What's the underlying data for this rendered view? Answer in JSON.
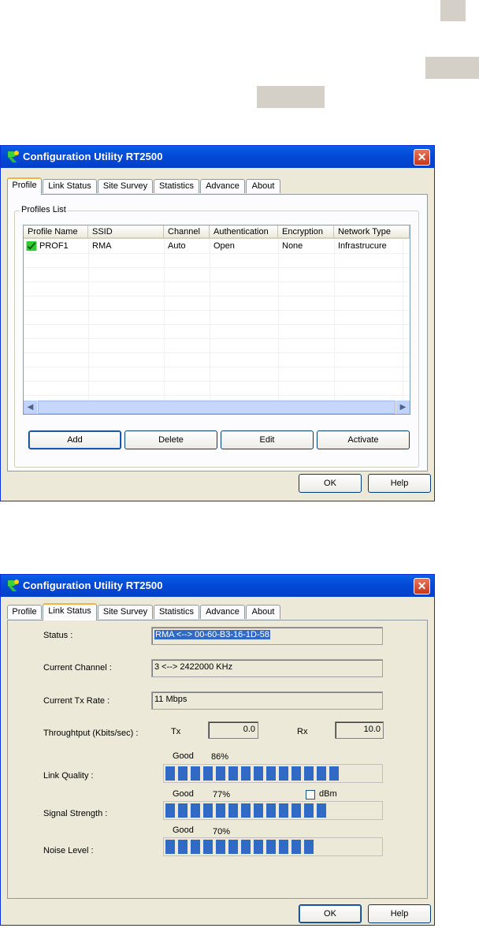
{
  "windows": [
    {
      "title": "Configuration Utility RT2500",
      "tabs": [
        "Profile",
        "Link Status",
        "Site Survey",
        "Statistics",
        "Advance",
        "About"
      ],
      "active_tab": "Profile",
      "profiles_group_label": "Profiles List",
      "columns": [
        "Profile Name",
        "SSID",
        "Channel",
        "Authentication",
        "Encryption",
        "Network Type"
      ],
      "rows": [
        [
          "PROF1",
          "RMA",
          "Auto",
          "Open",
          "None",
          "Infrastrucure"
        ]
      ],
      "buttons": {
        "add": "Add",
        "delete": "Delete",
        "edit": "Edit",
        "activate": "Activate"
      },
      "footer": {
        "ok": "OK",
        "help": "Help"
      }
    },
    {
      "title": "Configuration Utility RT2500",
      "tabs": [
        "Profile",
        "Link Status",
        "Site Survey",
        "Statistics",
        "Advance",
        "About"
      ],
      "active_tab": "Link Status",
      "status_label": "Status :",
      "status_value": "RMA <--> 00-60-B3-16-1D-58",
      "channel_label": "Current Channel :",
      "channel_value": "3 <--> 2422000 KHz",
      "txrate_label": "Current Tx Rate :",
      "txrate_value": "11 Mbps",
      "throughput_label": "Throughtput (Kbits/sec) :",
      "tx_label": "Tx",
      "tx_value": "0.0",
      "rx_label": "Rx",
      "rx_value": "10.0",
      "link_quality": {
        "label": "Link Quality :",
        "rating": "Good",
        "percent_text": "86%",
        "percent": 86
      },
      "signal_strength": {
        "label": "Signal Strength :",
        "rating": "Good",
        "percent_text": "77%",
        "percent": 77
      },
      "dbm_label": "dBm",
      "noise_level": {
        "label": "Noise Level :",
        "rating": "Good",
        "percent_text": "70%",
        "percent": 70
      },
      "footer": {
        "ok": "OK",
        "help": "Help"
      }
    }
  ],
  "colors": {
    "titlebar": "#0348d6",
    "bar": "#316ac5",
    "panel": "#ece9d8",
    "close": "#c6371a"
  },
  "icons": {
    "title": "rt-logo-icon",
    "close": "close-icon",
    "profile_active": "checkmark-icon",
    "scroll_left": "scroll-left-icon",
    "scroll_right": "scroll-right-icon"
  }
}
